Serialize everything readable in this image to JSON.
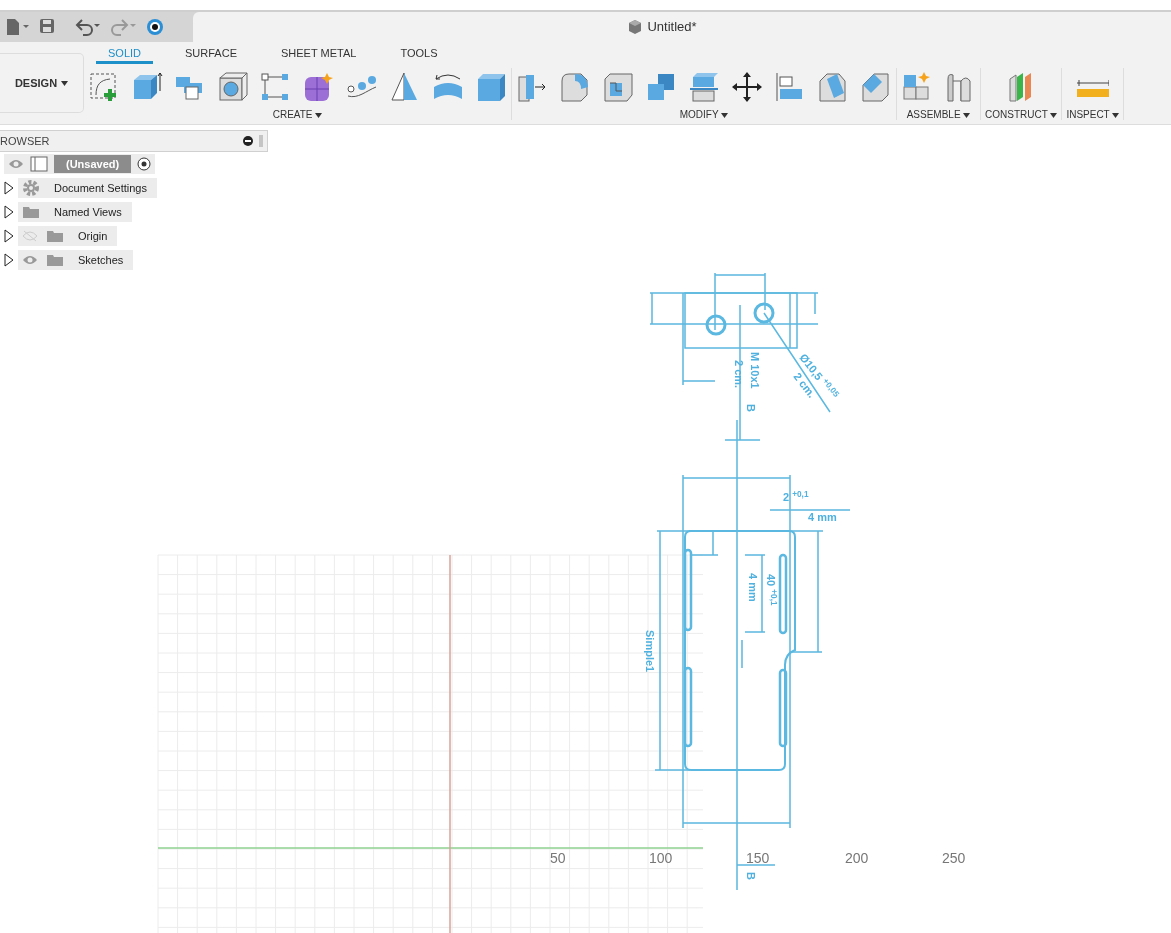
{
  "document_tab": {
    "title": "Untitled*"
  },
  "quick_access": [
    {
      "kind": "file"
    },
    {
      "kind": "save"
    },
    {
      "kind": "undo"
    },
    {
      "kind": "redo"
    },
    {
      "kind": "job"
    }
  ],
  "toolbar": {
    "workspace": "DESIGN",
    "tabs": [
      {
        "label": "SOLID",
        "selected": true
      },
      {
        "label": "SURFACE",
        "selected": false
      },
      {
        "label": "SHEET METAL",
        "selected": false
      },
      {
        "label": "TOOLS",
        "selected": false
      }
    ],
    "groups": [
      {
        "label": "CREATE",
        "tools": [
          {
            "kind": "sketch"
          },
          {
            "kind": "extrude"
          },
          {
            "kind": "combine"
          },
          {
            "kind": "hole"
          },
          {
            "kind": "pattern"
          },
          {
            "kind": "form"
          },
          {
            "kind": "spline"
          },
          {
            "kind": "loft"
          },
          {
            "kind": "revolve"
          },
          {
            "kind": "box"
          }
        ]
      },
      {
        "label": "MODIFY",
        "tools": [
          {
            "kind": "presspull"
          },
          {
            "kind": "fillet"
          },
          {
            "kind": "shell"
          },
          {
            "kind": "cubes"
          },
          {
            "kind": "split"
          },
          {
            "kind": "move"
          },
          {
            "kind": "align"
          },
          {
            "kind": "draft"
          },
          {
            "kind": "chamfer"
          }
        ]
      },
      {
        "label": "ASSEMBLE",
        "tools": [
          {
            "kind": "newcomp"
          },
          {
            "kind": "joint"
          }
        ]
      },
      {
        "label": "CONSTRUCT",
        "tools": [
          {
            "kind": "plane"
          }
        ]
      },
      {
        "label": "INSPECT",
        "tools": [
          {
            "kind": "measure"
          }
        ]
      }
    ]
  },
  "browser": {
    "title": "ROWSER",
    "root": {
      "label": "(Unsaved)",
      "visible": true
    },
    "items": [
      {
        "label": "Document Settings",
        "kind": "settings",
        "expanded": false
      },
      {
        "label": "Named Views",
        "kind": "folder",
        "expanded": false
      },
      {
        "label": "Origin",
        "kind": "folder",
        "expanded": false,
        "visible": false
      },
      {
        "label": "Sketches",
        "kind": "folder",
        "expanded": false,
        "visible": true
      }
    ]
  },
  "canvas": {
    "axis_labels": [
      "50",
      "100",
      "150",
      "200",
      "250"
    ],
    "drawing_labels": [
      "M 10x1",
      "2 cm.",
      "Ø10,5 $^{+0,05}$",
      "2 cm.",
      "B",
      "2 $^{+0,1}$",
      "4 mm",
      "40 $^{+0,1}$",
      "4 mm",
      "Simple1",
      "B"
    ]
  }
}
